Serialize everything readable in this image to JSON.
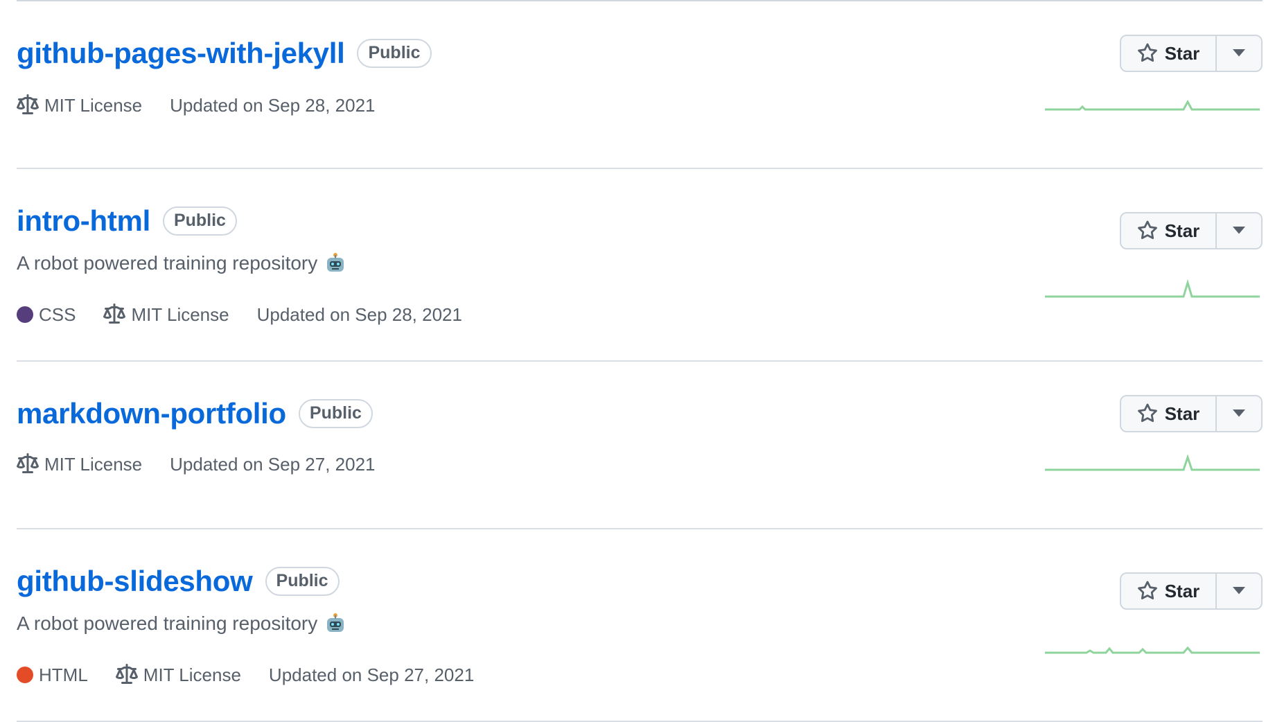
{
  "repos": [
    {
      "name": "github-pages-with-jekyll",
      "visibility": "Public",
      "description": "",
      "language": null,
      "license": "MIT License",
      "updated": "Updated on Sep 28, 2021",
      "star_label": "Star"
    },
    {
      "name": "intro-html",
      "visibility": "Public",
      "description": "A robot powered training repository",
      "language": {
        "name": "CSS",
        "color": "#563d7c"
      },
      "license": "MIT License",
      "updated": "Updated on Sep 28, 2021",
      "star_label": "Star"
    },
    {
      "name": "markdown-portfolio",
      "visibility": "Public",
      "description": "",
      "language": null,
      "license": "MIT License",
      "updated": "Updated on Sep 27, 2021",
      "star_label": "Star"
    },
    {
      "name": "github-slideshow",
      "visibility": "Public",
      "description": "A robot powered training repository",
      "language": {
        "name": "HTML",
        "color": "#e34c26"
      },
      "license": "MIT License",
      "updated": "Updated on Sep 27, 2021",
      "star_label": "Star"
    }
  ],
  "colors": {
    "link": "#0969da",
    "sparkline": "#8fd49c",
    "border": "#d0d7de"
  },
  "icons": {
    "license": "law-icon",
    "star": "star-icon",
    "dropdown": "triangle-down-icon",
    "emoji": "robot-emoji"
  }
}
